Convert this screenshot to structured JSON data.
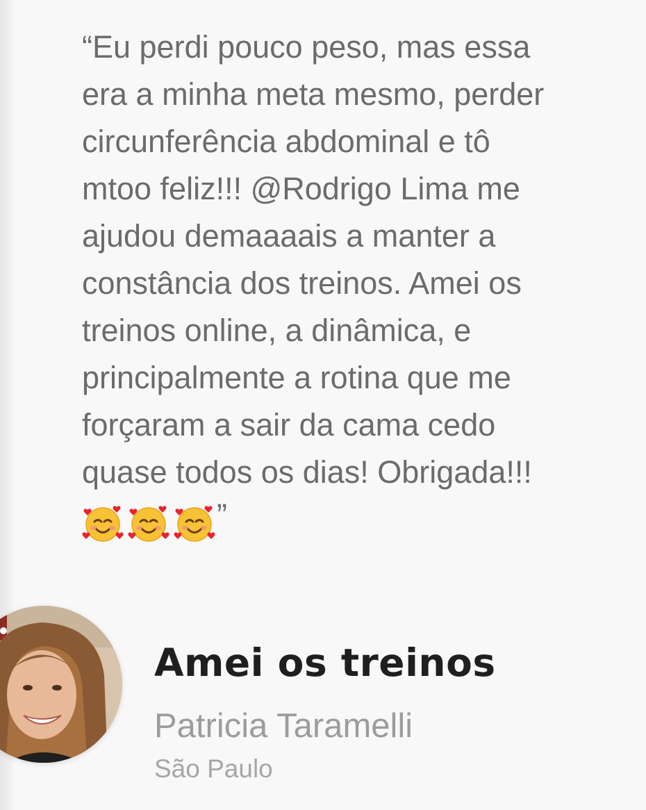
{
  "testimonial": {
    "quote_text": "“Eu perdi pouco peso, mas essa\nera a minha meta mesmo, perder\ncircunferência abdominal e tô\nmtoo feliz!!! @Rodrigo Lima me\najudou demaaaais a manter a\nconstância dos treinos. Amei os\ntreinos online, a dinâmica, e\nprincipalmente a rotina que me\nforçaram a sair da cama cedo\nquase todos os dias! Obrigada!!!",
    "quote_emojis": [
      "🥰",
      "🥰",
      "🥰"
    ],
    "quote_close": "”",
    "title": "Amei os treinos",
    "author_name": "Patricia Taramelli",
    "author_city": "São Paulo",
    "avatar_icon": "person-photo"
  },
  "colors": {
    "background": "#f8f8f8",
    "quote_text": "#6b6b6b",
    "title_text": "#1f1f1f",
    "name_text": "#9c9c9c",
    "city_text": "#a6a6a6"
  }
}
